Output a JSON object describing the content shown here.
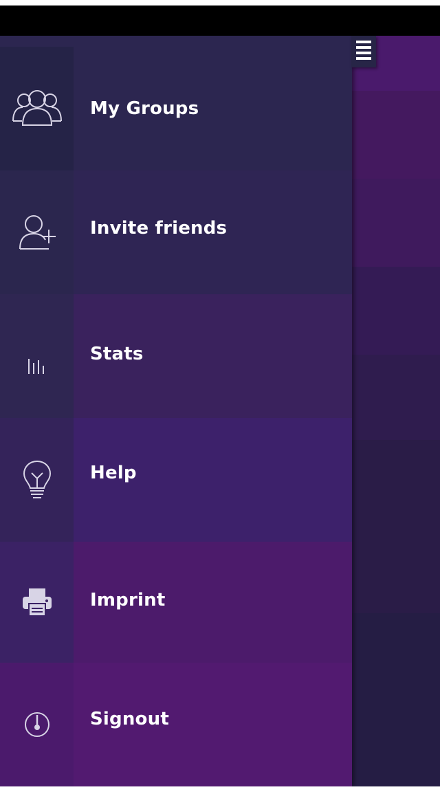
{
  "colors": {
    "status_bar": "#000000",
    "hamburger_bg": "#272547",
    "right_panel": [
      "#4a1a6c",
      "#44195f",
      "#3f1a5d",
      "#341b55",
      "#2f1c4e",
      "#2a1c47",
      "#251d44"
    ],
    "rows": [
      {
        "icon_bg": "#252347",
        "row_bg": "#2c2650"
      },
      {
        "icon_bg": "#2b264e",
        "row_bg": "#2f2554"
      },
      {
        "icon_bg": "#2f2652",
        "row_bg": "#3a225d"
      },
      {
        "icon_bg": "#34235a",
        "row_bg": "#3d216b"
      },
      {
        "icon_bg": "#3b2265",
        "row_bg": "#4c1b6b"
      },
      {
        "icon_bg": "#4b1a6c",
        "row_bg": "#521a70"
      }
    ]
  },
  "menu": {
    "toggle_icon": "hamburger-icon",
    "items": [
      {
        "label": "My Groups",
        "icon": "groups-icon"
      },
      {
        "label": "Invite friends",
        "icon": "add-user-icon"
      },
      {
        "label": "Stats",
        "icon": "bar-chart-icon"
      },
      {
        "label": "Help",
        "icon": "lightbulb-icon"
      },
      {
        "label": "Imprint",
        "icon": "printer-icon"
      },
      {
        "label": "Signout",
        "icon": "power-icon"
      }
    ]
  }
}
